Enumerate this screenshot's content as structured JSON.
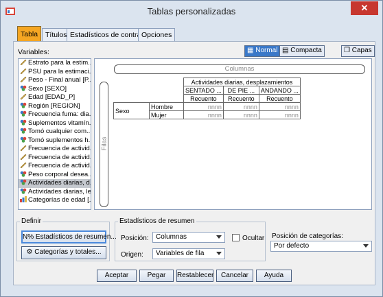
{
  "window": {
    "title": "Tablas personalizadas",
    "close_label": "✕"
  },
  "tabs": [
    {
      "label": "Tabla"
    },
    {
      "label": "Títulos"
    },
    {
      "label": "Estadísticos de contraste"
    },
    {
      "label": "Opciones"
    }
  ],
  "variables_label": "Variables:",
  "variables": [
    {
      "label": "Estrato para la estim...",
      "icon": "ruler-icon"
    },
    {
      "label": "PSU para la estimaci...",
      "icon": "ruler-icon"
    },
    {
      "label": "Peso - Final anual [P...",
      "icon": "ruler-icon"
    },
    {
      "label": "Sexo [SEXO]",
      "icon": "nominal-icon"
    },
    {
      "label": "Edad [EDAD_P]",
      "icon": "ruler-icon"
    },
    {
      "label": "Región [REGION]",
      "icon": "nominal-icon"
    },
    {
      "label": "Frecuencia fuma: dia...",
      "icon": "nominal-icon"
    },
    {
      "label": "Suplementos vitamín...",
      "icon": "nominal-icon"
    },
    {
      "label": "Tomó cualquier com...",
      "icon": "nominal-icon"
    },
    {
      "label": "Tomó suplementos h...",
      "icon": "nominal-icon"
    },
    {
      "label": "Frecuencia de activid...",
      "icon": "ruler-icon"
    },
    {
      "label": "Frecuencia de activid...",
      "icon": "ruler-icon"
    },
    {
      "label": "Frecuencia de activid...",
      "icon": "ruler-icon"
    },
    {
      "label": "Peso corporal desea...",
      "icon": "nominal-icon"
    },
    {
      "label": "Actividades diarias, d...",
      "icon": "nominal-icon",
      "selected": true
    },
    {
      "label": "Actividades diarias, lev...",
      "icon": "nominal-icon"
    },
    {
      "label": "Categorías de edad [...",
      "icon": "bars-icon"
    }
  ],
  "view": {
    "normal": "Normal",
    "compact": "Compacta",
    "layers": "Capas"
  },
  "canvas": {
    "columns_label": "Columnas",
    "rows_label": "Filas",
    "col_var": "Actividades diarias, desplazamientos",
    "col_cats": [
      "SENTADO ...",
      "DE PIE ...",
      "ANDANDO ..."
    ],
    "stat": "Recuento",
    "row_var": "Sexo",
    "row_cats": [
      "Hombre",
      "Mujer"
    ],
    "cell": "nnnn"
  },
  "definir": {
    "title": "Definir",
    "summary_btn": "Estadísticos de resumen...",
    "cats_btn": "Categorías y totales..."
  },
  "summary": {
    "title": "Estadísticos de resumen",
    "position_label": "Posición:",
    "position_value": "Columnas",
    "hide_label": "Ocultar",
    "source_label": "Origen:",
    "source_value": "Variables de fila"
  },
  "category_position": {
    "label": "Posición de categorías:",
    "value": "Por defecto"
  },
  "buttons": {
    "ok": "Aceptar",
    "paste": "Pegar",
    "reset": "Restablecer",
    "cancel": "Cancelar",
    "help": "Ayuda"
  }
}
